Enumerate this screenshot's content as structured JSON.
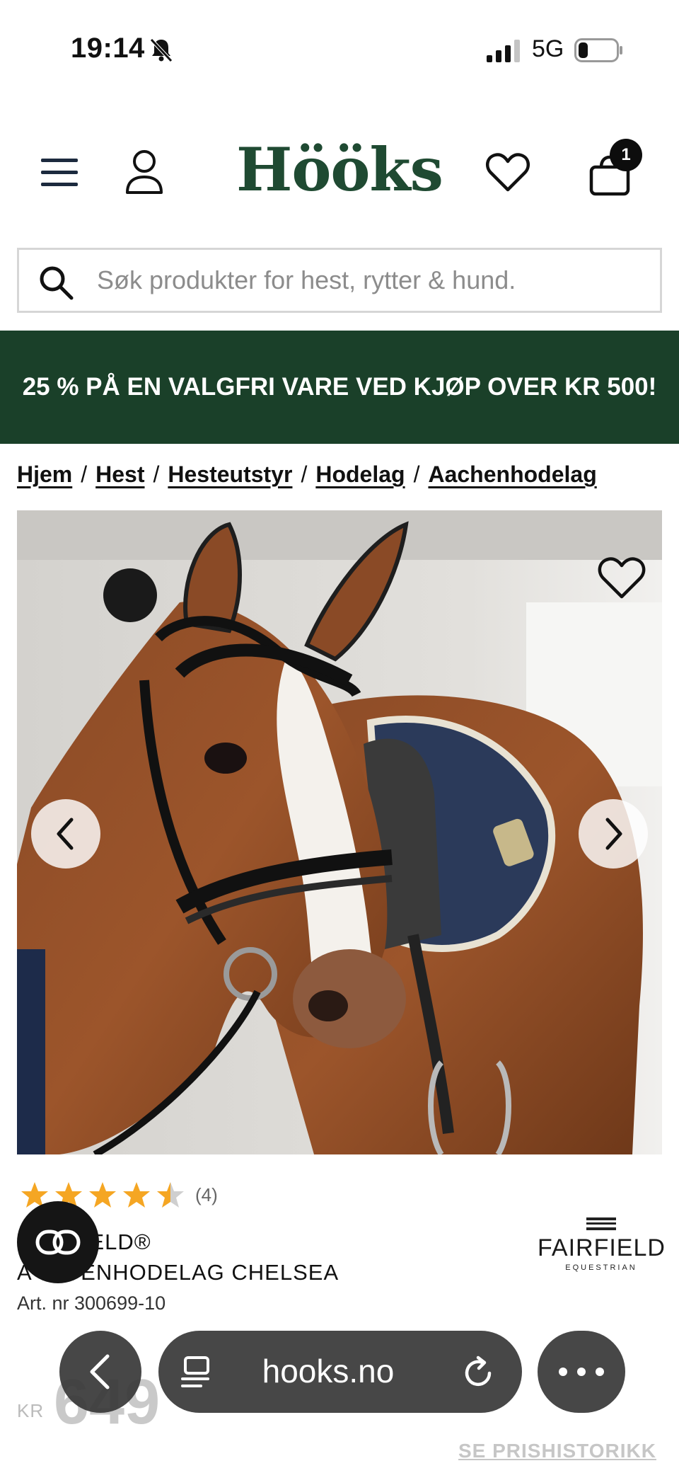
{
  "status_bar": {
    "time": "19:14",
    "network": "5G"
  },
  "header": {
    "logo": "Hööks",
    "cart_count": "1"
  },
  "search": {
    "placeholder": "Søk produkter for hest, rytter & hund."
  },
  "promo": {
    "text": "25 % PÅ EN VALGFRI VARE VED KJØP OVER KR 500!"
  },
  "breadcrumb": [
    "Hjem",
    "Hest",
    "Hesteutstyr",
    "Hodelag",
    "Aachenhodelag"
  ],
  "product": {
    "rating": 4.5,
    "review_count": "(4)",
    "brand": "FAIRFIELD®",
    "brand_visible": "ELD®",
    "title": "AACHENHODELAG CHELSEA",
    "title_visible_prefix": "A",
    "title_visible_suffix": "ENHODELAG CHELSEA",
    "art_nr": "Art. nr 300699-10",
    "brand_logo_main": "FAIRFIELD",
    "brand_logo_sub": "EQUESTRIAN",
    "currency": "KR",
    "price": "649",
    "price_history_link": "SE PRISHISTORIKK"
  },
  "browser": {
    "url": "hooks.no"
  },
  "icons": {
    "menu": "hamburger-menu-icon",
    "account": "user-icon",
    "wishlist": "heart-icon",
    "cart": "shopping-bag-icon",
    "search": "search-icon",
    "chat": "chat-icon"
  },
  "colors": {
    "brand_green": "#1f4a32",
    "promo_bg": "#1a4029",
    "star": "#f5a623"
  }
}
